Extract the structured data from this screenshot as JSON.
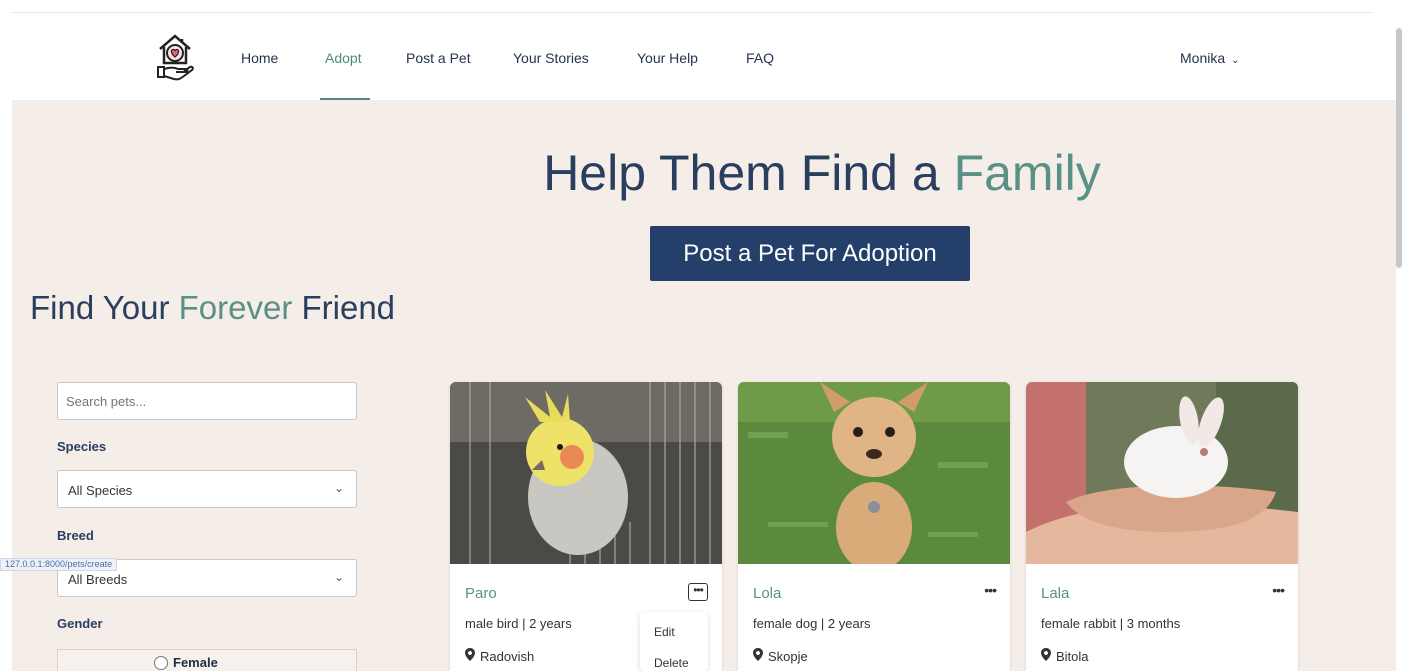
{
  "nav": {
    "links": [
      {
        "label": "Home"
      },
      {
        "label": "Adopt"
      },
      {
        "label": "Post a Pet"
      },
      {
        "label": "Your Stories"
      },
      {
        "label": "Your Help"
      },
      {
        "label": "FAQ"
      }
    ],
    "active": "Adopt",
    "user": "Monika"
  },
  "hero": {
    "title_part1": "Help Them Find a ",
    "title_accent": "Family",
    "button": "Post a Pet For Adoption"
  },
  "section": {
    "title_part1": "Find Your ",
    "title_accent": "Forever",
    "title_part2": " Friend"
  },
  "filters": {
    "search_placeholder": "Search pets...",
    "species_label": "Species",
    "species_value": "All Species",
    "breed_label": "Breed",
    "breed_value": "All Breeds",
    "gender_label": "Gender",
    "gender_option": "Female"
  },
  "status_url": "127.0.0.1:8000/pets/create",
  "pets": [
    {
      "name": "Paro",
      "info": "male bird | 2 years",
      "location": "Radovish"
    },
    {
      "name": "Lola",
      "info": "female dog | 2 years",
      "location": "Skopje"
    },
    {
      "name": "Lala",
      "info": "female rabbit | 3 months",
      "location": "Bitola"
    }
  ],
  "menu": {
    "edit": "Edit",
    "delete": "Delete",
    "more": "•••"
  },
  "colors": {
    "accent": "#5a9186",
    "navy": "#24406a",
    "background": "#f5ede8"
  }
}
